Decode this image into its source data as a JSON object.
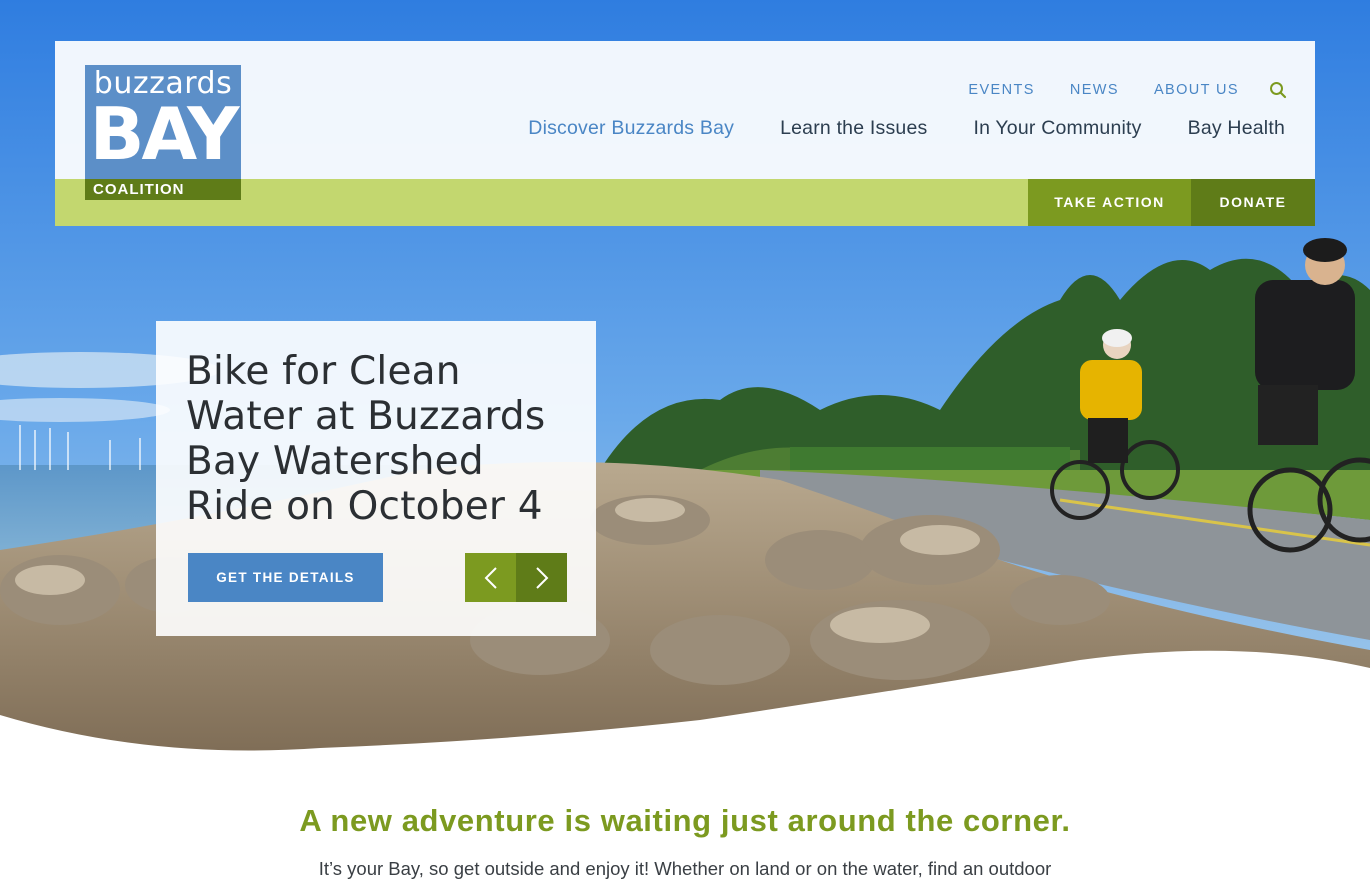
{
  "logo": {
    "top": "buzzards",
    "big": "BAY",
    "bottom": "COALITION"
  },
  "utility_nav": [
    "EVENTS",
    "NEWS",
    "ABOUT US"
  ],
  "main_nav": [
    {
      "label": "Discover Buzzards Bay",
      "active": true
    },
    {
      "label": "Learn the Issues"
    },
    {
      "label": "In Your Community"
    },
    {
      "label": "Bay Health"
    }
  ],
  "action_buttons": {
    "take_action": "TAKE ACTION",
    "donate": "DONATE"
  },
  "slide": {
    "title": "Bike for Clean Water at Buzzards Bay Watershed Ride on October 4",
    "cta": "GET THE DETAILS"
  },
  "tagline": "A new adventure is waiting just around the corner.",
  "intro": "It’s your Bay, so get outside and enjoy it! Whether on land or on the water, find an outdoor",
  "colors": {
    "brand_blue": "#4a86c5",
    "brand_green": "#7c9a20",
    "dark_green": "#5f7c18",
    "light_green_bar": "#c3d76f"
  }
}
